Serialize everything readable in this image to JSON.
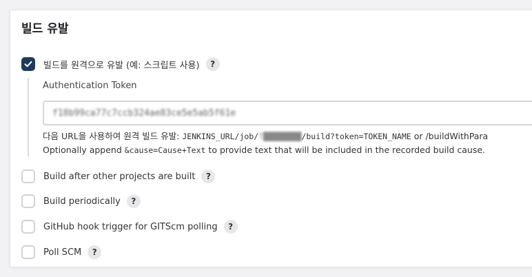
{
  "section": {
    "title": "빌드 유발"
  },
  "remote_trigger": {
    "label": "빌드를 원격으로 유발 (예: 스크립트 사용)",
    "checked": true,
    "token_label": "Authentication Token",
    "token_value": "f18b99ca77c7ccb324ae83ce5e5ab5f61e",
    "url_help_prefix": "다음 URL을 사용하여 원격 빌드 유발: ",
    "url_help_jenkins": "JENKINS_URL/job/",
    "url_help_job": "T████████",
    "url_help_rest": "/build?token=",
    "url_help_token": "TOKEN_NAME",
    "url_help_suffix": " or /buildWithPara",
    "cause_prefix": "Optionally append ",
    "cause_code": "&cause=Cause+Text",
    "cause_suffix": " to provide text that will be included in the recorded build cause."
  },
  "triggers": [
    {
      "label": "Build after other projects are built",
      "checked": false
    },
    {
      "label": "Build periodically",
      "checked": false
    },
    {
      "label": "GitHub hook trigger for GITScm polling",
      "checked": false
    },
    {
      "label": "Poll SCM",
      "checked": false
    }
  ],
  "help_glyph": "?",
  "colors": {
    "checked_bg": "#1d3c5c",
    "checkbox_border": "#cfd3d9",
    "help_bg": "#e7e7ea"
  }
}
